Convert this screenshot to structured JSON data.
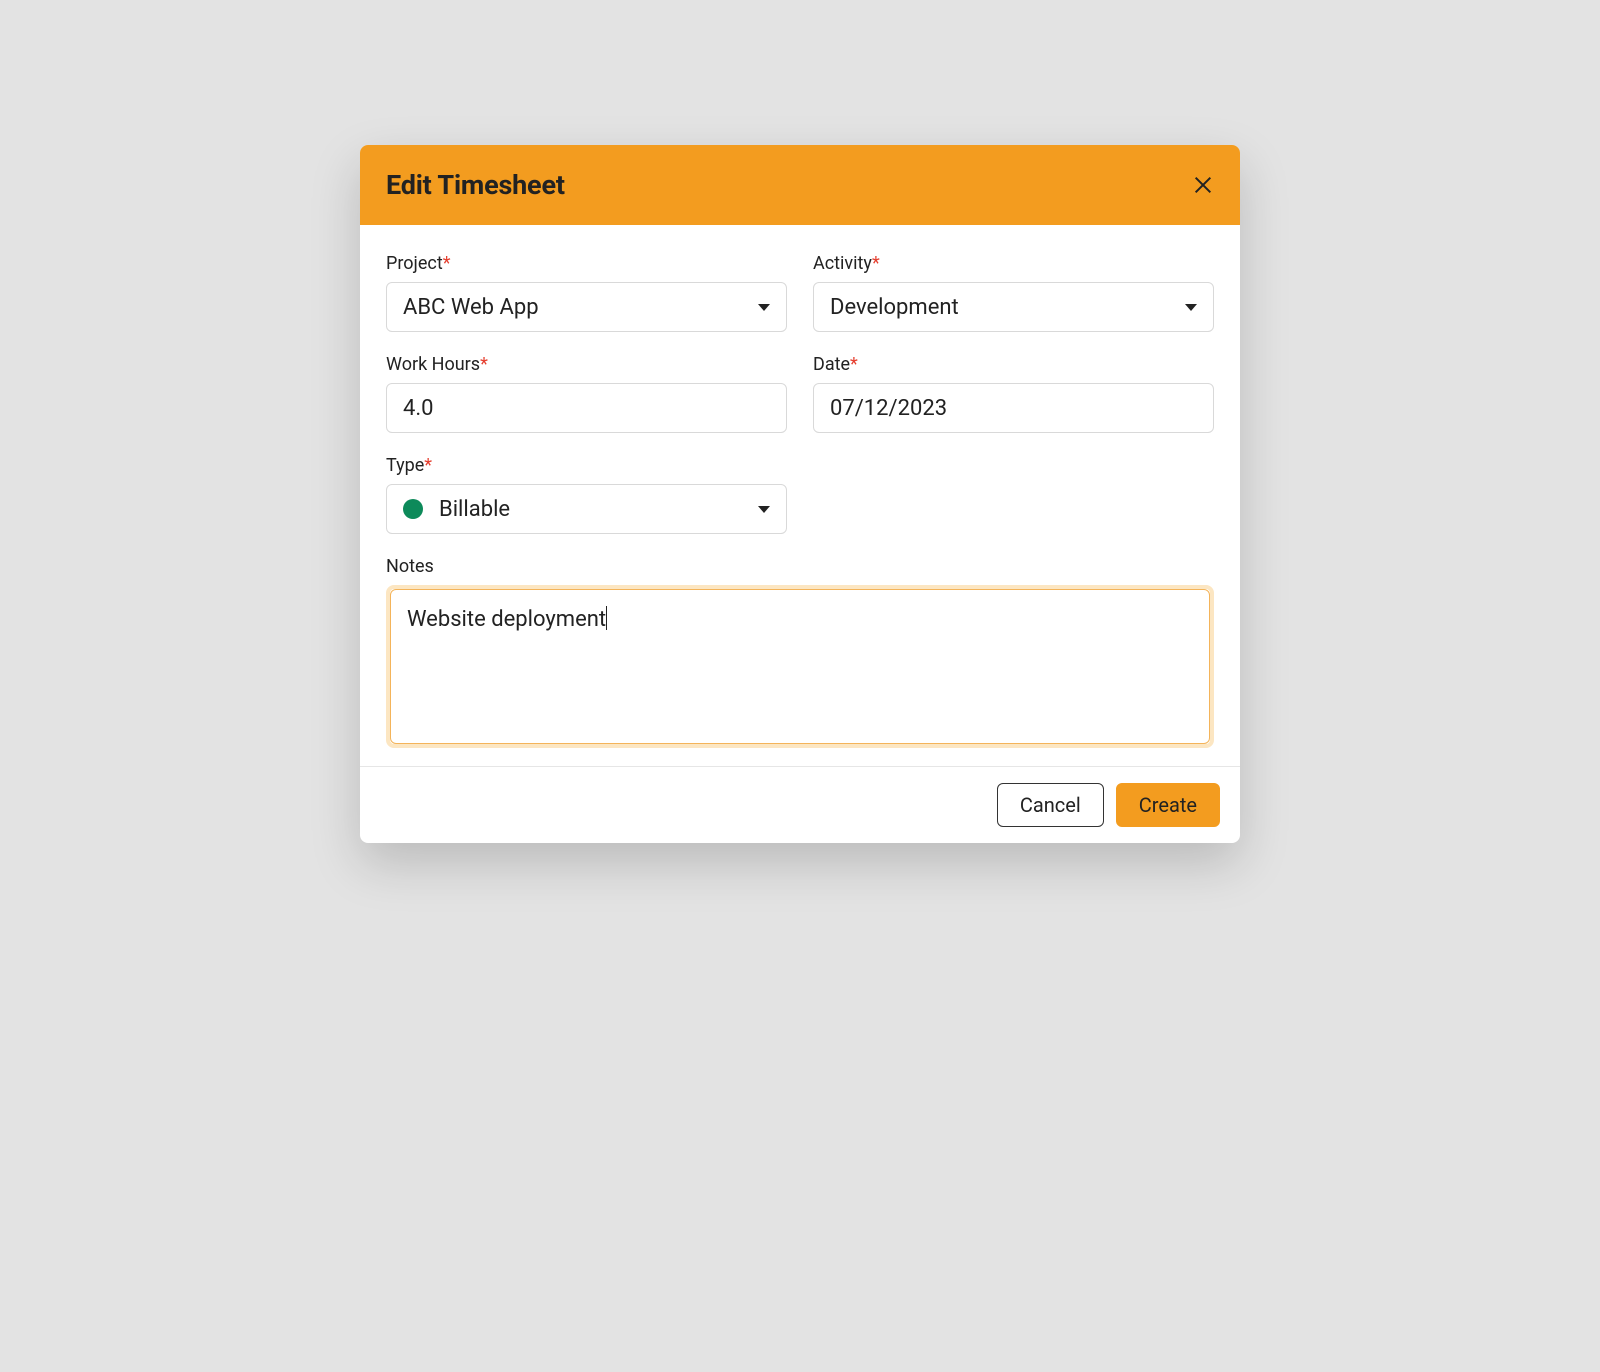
{
  "header": {
    "title": "Edit Timesheet"
  },
  "form": {
    "project": {
      "label": "Project",
      "required": "*",
      "value": "ABC Web App"
    },
    "activity": {
      "label": "Activity",
      "required": "*",
      "value": "Development"
    },
    "work_hours": {
      "label": "Work Hours",
      "required": "*",
      "value": "4.0"
    },
    "date": {
      "label": "Date",
      "required": "*",
      "value": "07/12/2023"
    },
    "type": {
      "label": "Type",
      "required": "*",
      "value": "Billable",
      "status_color": "#0d8a5a"
    },
    "notes": {
      "label": "Notes",
      "value": "Website deployment"
    }
  },
  "footer": {
    "cancel": "Cancel",
    "create": "Create"
  }
}
